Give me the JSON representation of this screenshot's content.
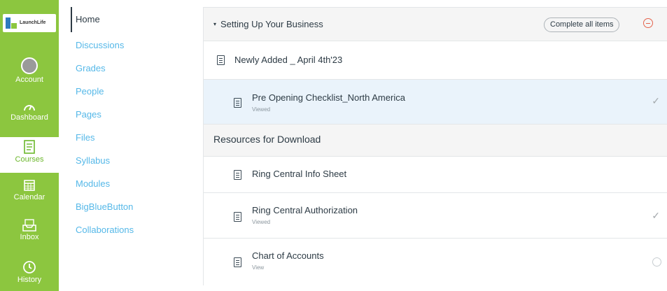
{
  "global_nav": {
    "logo_text": "LaunchLife",
    "logo_sub": "",
    "items": [
      {
        "label": "Account",
        "icon": "avatar-icon"
      },
      {
        "label": "Dashboard",
        "icon": "dashboard-icon"
      },
      {
        "label": "Courses",
        "icon": "courses-icon"
      },
      {
        "label": "Calendar",
        "icon": "calendar-icon"
      },
      {
        "label": "Inbox",
        "icon": "inbox-icon"
      },
      {
        "label": "History",
        "icon": "history-icon"
      }
    ],
    "colors": {
      "accent": "#8cc63f",
      "active_text": "#6bb72b"
    }
  },
  "course_nav": {
    "items": [
      "Home",
      "Discussions",
      "Grades",
      "People",
      "Pages",
      "Files",
      "Syllabus",
      "Modules",
      "BigBlueButton",
      "Collaborations"
    ]
  },
  "module": {
    "title": "Setting Up Your Business",
    "complete_label": "Complete all items",
    "items": [
      {
        "title": "Newly Added _ April 4th'23",
        "sub": ""
      },
      {
        "title": "Pre Opening Checklist_North America",
        "sub": "Viewed",
        "status": "check"
      },
      {
        "title": "Resources for Download",
        "type": "subheader"
      },
      {
        "title": "Ring Central Info Sheet",
        "sub": ""
      },
      {
        "title": "Ring Central Authorization",
        "sub": "Viewed",
        "status": "check"
      },
      {
        "title": "Chart of Accounts",
        "sub": "View",
        "status": "circle"
      }
    ]
  }
}
